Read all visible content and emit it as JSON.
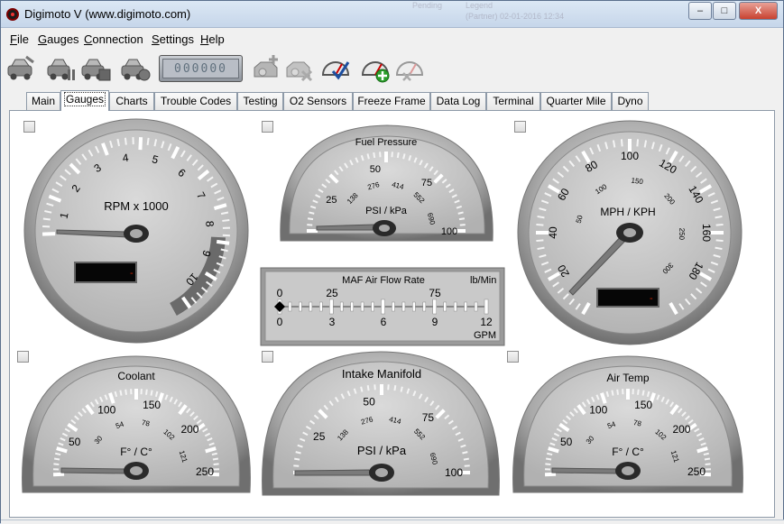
{
  "window": {
    "title": "Digimoto V (www.digimoto.com)",
    "bg_text_1": "Pending",
    "bg_text_2": "Legend",
    "bg_text_3": "(Partner) 02-01-2016 12:34",
    "min_symbol": "–",
    "max_symbol": "□",
    "close_symbol": "X"
  },
  "menu": [
    {
      "label": "File",
      "ul": "F",
      "rest": "ile"
    },
    {
      "label": "Gauges",
      "ul": "G",
      "rest": "auges"
    },
    {
      "label": "Connection",
      "ul": "C",
      "rest": "onnection"
    },
    {
      "label": "Settings",
      "ul": "S",
      "rest": "ettings"
    },
    {
      "label": "Help",
      "ul": "H",
      "rest": "elp"
    }
  ],
  "toolbar": {
    "counter": "000000",
    "icons": [
      "connect-car-icon",
      "car-pause-icon",
      "car-stop-icon",
      "car-record-icon",
      "engine-add-icon",
      "engine-remove-icon",
      "gauge-edit-icon",
      "gauge-add-icon",
      "gauge-remove-icon"
    ]
  },
  "tabs": [
    "Main",
    "Gauges",
    "Charts",
    "Trouble Codes",
    "Testing",
    "O2 Sensors",
    "Freeze Frame",
    "Data Log",
    "Terminal",
    "Quarter Mile",
    "Dyno"
  ],
  "active_tab": "Gauges",
  "gauges": {
    "rpm": {
      "title": "RPM x 1000",
      "labels": [
        "1",
        "2",
        "3",
        "4",
        "5",
        "6",
        "7",
        "8",
        "9",
        "10"
      ],
      "readout": "-",
      "redline_color": "#ffffff"
    },
    "fuel": {
      "title": "Fuel Pressure",
      "unit": "PSI / kPa",
      "outer": [
        "25",
        "50",
        "75",
        "100"
      ],
      "inner": [
        "138",
        "276",
        "414",
        "552",
        "690"
      ]
    },
    "mph": {
      "title": "MPH / KPH",
      "outer": [
        "20",
        "40",
        "60",
        "80",
        "100",
        "120",
        "140",
        "160",
        "180"
      ],
      "inner": [
        "50",
        "100",
        "150",
        "200",
        "250",
        "300"
      ],
      "readout": "-"
    },
    "maf": {
      "title": "MAF Air Flow Rate",
      "unit_top": "lb/Min",
      "unit_bottom": "GPM",
      "top_labels": [
        "0",
        "25",
        "75"
      ],
      "bottom_labels": [
        "0",
        "3",
        "6",
        "9",
        "12"
      ]
    },
    "coolant": {
      "title": "Coolant",
      "unit": "F° / C°",
      "outer": [
        "50",
        "100",
        "150",
        "200",
        "250"
      ],
      "inner": [
        "30",
        "54",
        "78",
        "102",
        "121"
      ]
    },
    "intake": {
      "title": "Intake Manifold",
      "unit": "PSI / kPa",
      "outer": [
        "25",
        "50",
        "75",
        "100"
      ],
      "inner": [
        "138",
        "276",
        "414",
        "552",
        "690"
      ]
    },
    "airtemp": {
      "title": "Air Temp",
      "unit": "F° / C°",
      "outer": [
        "50",
        "100",
        "150",
        "200",
        "250"
      ],
      "inner": [
        "30",
        "54",
        "78",
        "102",
        "121"
      ]
    }
  },
  "colors": {
    "accent_readout": "#cc2200",
    "gauge_face": "#c4c4c4"
  }
}
